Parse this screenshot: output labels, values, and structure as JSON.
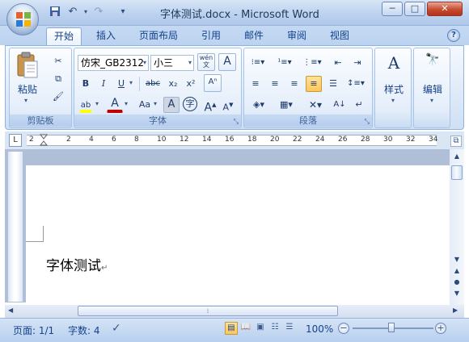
{
  "window": {
    "title": "字体测试.docx - Microsoft Word",
    "controls": {
      "minimize": "─",
      "maximize": "□",
      "close": "✕"
    }
  },
  "quick_access": {
    "save_icon": "💾",
    "undo_icon": "↶",
    "redo_icon": "↷",
    "more_icon": "▾"
  },
  "tabs": [
    "开始",
    "插入",
    "页面布局",
    "引用",
    "邮件",
    "审阅",
    "视图"
  ],
  "active_tab": "开始",
  "help": "?",
  "ribbon": {
    "clipboard": {
      "label": "剪贴板",
      "paste": "粘贴"
    },
    "font": {
      "label": "字体",
      "font_name": "仿宋_GB2312",
      "font_size": "小三",
      "bold": "B",
      "italic": "I",
      "underline": "U",
      "strike": "abc",
      "subscript": "x₂",
      "superscript": "x²",
      "font_color": "A",
      "change_case": "Aa",
      "grow": "A",
      "shrink": "A",
      "phonetic": "wén\n文",
      "char_border": "A",
      "enclose": "字",
      "clear": "Aⁿ"
    },
    "paragraph": {
      "label": "段落"
    },
    "styles": {
      "label": "样式",
      "icon": "A"
    },
    "editing": {
      "label": "编辑",
      "icon": "A"
    }
  },
  "ruler": {
    "numbers": [
      "2",
      "2",
      "4",
      "6",
      "8",
      "10",
      "12",
      "14",
      "16",
      "18",
      "20",
      "22",
      "24",
      "26",
      "28",
      "30",
      "32",
      "34"
    ]
  },
  "document": {
    "text": "字体测试",
    "pilcrow": "↵"
  },
  "status": {
    "page": "页面: 1/1",
    "words": "字数: 4",
    "zoom": "100%",
    "minus": "−",
    "plus": "+"
  },
  "colors": {
    "accent": "#15428b",
    "title_bg": "#c4d9f3",
    "highlight": "#ffff00",
    "font_color": "#c00000"
  }
}
